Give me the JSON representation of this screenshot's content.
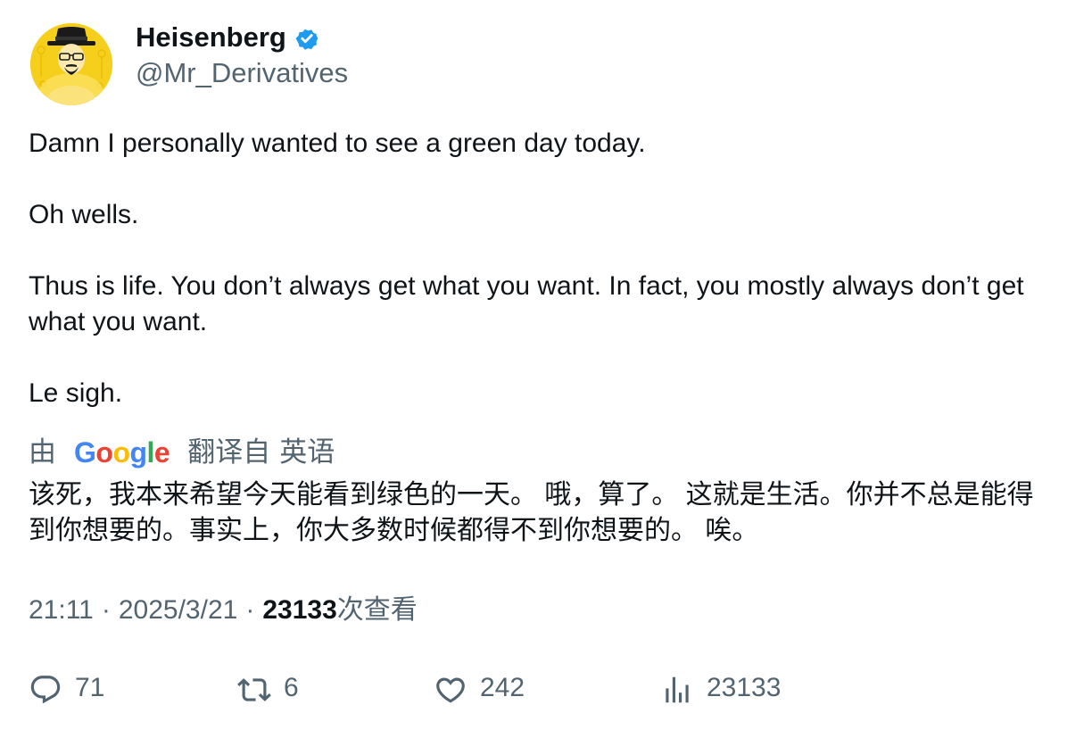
{
  "author": {
    "display_name": "Heisenberg",
    "handle": "@Mr_Derivatives",
    "verified": true,
    "verified_color": "#1d9bf0"
  },
  "tweet": {
    "paragraphs": [
      "Damn I personally wanted to see a green day today.",
      "Oh wells.",
      "Thus is life. You don’t always get what you want. In fact, you mostly always don’t get what you want.",
      "Le sigh."
    ]
  },
  "translation": {
    "prefix": "由",
    "provider_letters": [
      "G",
      "o",
      "o",
      "g",
      "l",
      "e"
    ],
    "suffix": "翻译自",
    "source_language": "英语",
    "text": "该死，我本来希望今天能看到绿色的一天。 哦，算了。 这就是生活。你并不总是能得到你想要的。事实上，你大多数时候都得不到你想要的。 唉。"
  },
  "meta": {
    "time": "21:11",
    "separator": "·",
    "date": "2025/3/21",
    "views_count": "23133",
    "views_label": "次查看"
  },
  "actions": {
    "reply_count": "71",
    "retweet_count": "6",
    "like_count": "242",
    "views_count": "23133"
  },
  "colors": {
    "text_primary": "#0f1419",
    "text_secondary": "#536471",
    "avatar_bg": "#f6cf1c"
  }
}
